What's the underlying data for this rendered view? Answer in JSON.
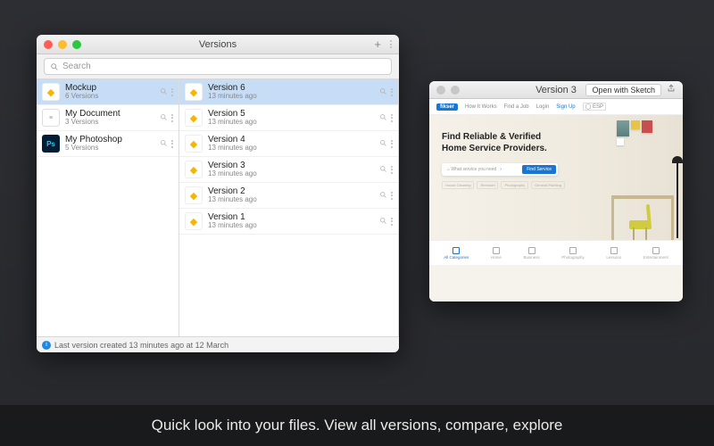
{
  "caption": "Quick look into your files. View all versions, compare, explore",
  "versionsWindow": {
    "title": "Versions",
    "searchPlaceholder": "Search",
    "statusText": "Last version created 13 minutes ago at 12 March",
    "files": [
      {
        "name": "Mockup",
        "sub": "6 Versions",
        "icon": "sketch",
        "selected": true
      },
      {
        "name": "My Document",
        "sub": "3 Versions",
        "icon": "doc",
        "selected": false
      },
      {
        "name": "My Photoshop",
        "sub": "5 Versions",
        "icon": "ps",
        "selected": false
      }
    ],
    "versions": [
      {
        "name": "Version 6",
        "sub": "13 minutes ago",
        "selected": true
      },
      {
        "name": "Version 5",
        "sub": "13 minutes ago",
        "selected": false
      },
      {
        "name": "Version 4",
        "sub": "13 minutes ago",
        "selected": false
      },
      {
        "name": "Version 3",
        "sub": "13 minutes ago",
        "selected": false
      },
      {
        "name": "Version 2",
        "sub": "13 minutes ago",
        "selected": false
      },
      {
        "name": "Version 1",
        "sub": "13 minutes ago",
        "selected": false
      }
    ]
  },
  "previewWindow": {
    "title": "Version 3",
    "openButton": "Open with Sketch",
    "site": {
      "logo": "fikser",
      "nav": [
        "How It Works",
        "Find a Job",
        "Login"
      ],
      "signup": "Sign Up",
      "langBadge": "ESP",
      "heroLine1": "Find Reliable & Verified",
      "heroLine2": "Home Service Providers.",
      "searchPlaceholder": "What service you need",
      "searchButton": "Find Service",
      "tags": [
        "House Cleaning",
        "Remodel",
        "Photography",
        "General Painting"
      ],
      "categories": [
        "All Categories",
        "Home",
        "Business",
        "Photography",
        "Lessons",
        "Entertainment"
      ]
    }
  }
}
